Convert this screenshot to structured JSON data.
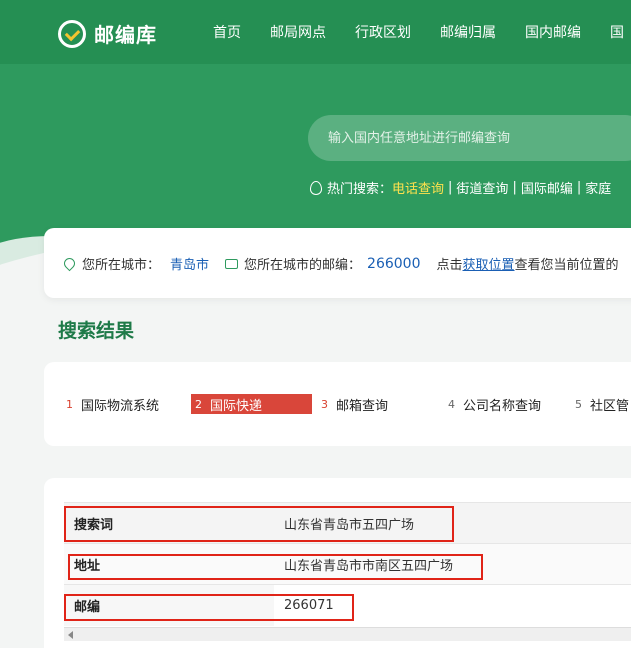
{
  "header": {
    "logo_text": "邮编库",
    "nav": [
      "首页",
      "邮局网点",
      "行政区划",
      "邮编归属",
      "国内邮编",
      "国"
    ]
  },
  "search": {
    "placeholder": "输入国内任意地址进行邮编查询"
  },
  "hot_search": {
    "label": "热门搜索：",
    "items": [
      "电话查询",
      "街道查询",
      "国际邮编",
      "家庭"
    ]
  },
  "city_bar": {
    "city_label": "您所在城市：",
    "city": "青岛市",
    "zip_label": "您所在城市的邮编：",
    "zip": "266000",
    "hint_prefix": "点击",
    "hint_link": "获取位置",
    "hint_suffix": "查看您当前位置的"
  },
  "section_title": "搜索结果",
  "tabs": [
    {
      "num": "1",
      "label": "国际物流系统"
    },
    {
      "num": "2",
      "label": "国际快递"
    },
    {
      "num": "3",
      "label": "邮箱查询"
    },
    {
      "num": "4",
      "label": "公司名称查询"
    },
    {
      "num": "5",
      "label": "社区管"
    }
  ],
  "result": {
    "rows": [
      {
        "key": "搜索词",
        "value": "山东省青岛市五四广场"
      },
      {
        "key": "地址",
        "value": "山东省青岛市市南区五四广场"
      },
      {
        "key": "邮编",
        "value": "266071"
      }
    ]
  },
  "colors": {
    "brand_green": "#2e9a5e",
    "highlight_red": "#e02418",
    "active_tab": "#d9463a",
    "link_blue": "#1a5fb4"
  }
}
